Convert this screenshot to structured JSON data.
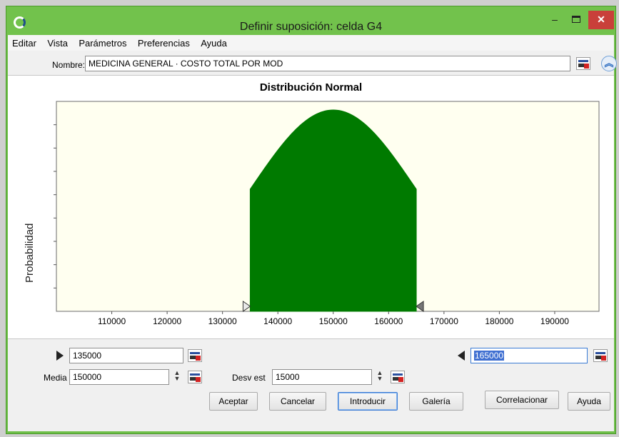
{
  "window": {
    "title": "Definir suposición: celda G4"
  },
  "menu": [
    {
      "label": "Editar"
    },
    {
      "label": "Vista"
    },
    {
      "label": "Parámetros"
    },
    {
      "label": "Preferencias"
    },
    {
      "label": "Ayuda"
    }
  ],
  "name_field": {
    "label": "Nombre:",
    "value": "MEDICINA GENERAL · COSTO TOTAL POR MOD"
  },
  "chart_data": {
    "type": "area",
    "title": "Distribución Normal",
    "xlabel": "",
    "ylabel": "Probabilidad",
    "xlim": [
      100000,
      198000
    ],
    "x_ticks": [
      110000,
      120000,
      130000,
      140000,
      150000,
      160000,
      170000,
      180000,
      190000
    ],
    "y_ticks_count": 8,
    "distribution": {
      "mean": 150000,
      "std": 15000
    },
    "shaded_range": [
      135000,
      165000
    ],
    "fill_color": "#007a00",
    "plot_background": "#fffff0",
    "grid": false
  },
  "lower_bound": {
    "value": "135000"
  },
  "upper_bound": {
    "value": "165000"
  },
  "mean_field": {
    "label": "Media",
    "value": "150000"
  },
  "std_field": {
    "label": "Desv est",
    "value": "15000"
  },
  "buttons": {
    "accept": "Aceptar",
    "cancel": "Cancelar",
    "enter": "Introducir",
    "gallery": "Galería",
    "correlate": "Correlacionar",
    "help": "Ayuda"
  },
  "colors": {
    "titlebar": "#72c24c",
    "close": "#c9403a"
  }
}
